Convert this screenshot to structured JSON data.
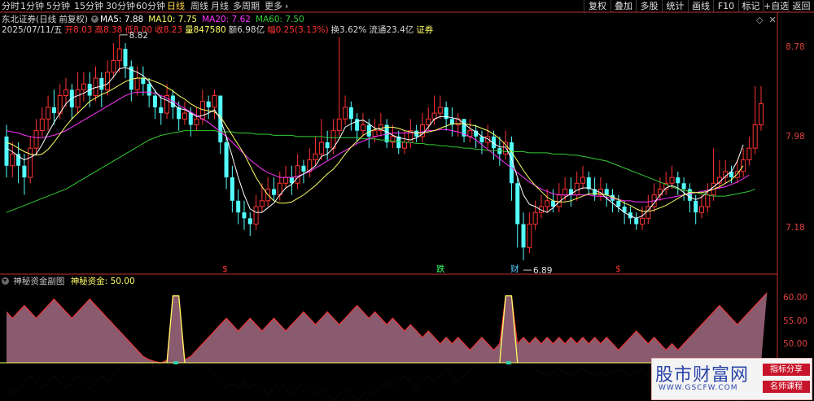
{
  "tabs": [
    "分时",
    "1分钟",
    "5分钟",
    "15分钟",
    "30分钟",
    "60分钟",
    "日线",
    "周线",
    "月线",
    "多周期",
    "更多"
  ],
  "active_tab": "日线",
  "more_icon": "chevron-right-icon",
  "toolbar": [
    "复权",
    "叠加",
    "多股",
    "统计",
    "画线",
    "F10",
    "标记",
    "+自选",
    "返回"
  ],
  "legend1": {
    "stock": "东北证券",
    "mode": "(日线 前复权)",
    "ma5": "MA5: 7.88",
    "ma10": "MA10: 7.75",
    "ma20": "MA20: 7.62",
    "ma60": "MA60: 7.50"
  },
  "legend2": {
    "date": "2025/07/11/五",
    "open": "开8.03",
    "high": "高8.38",
    "low": "低8.00",
    "close": "收8.23",
    "vol": "量847580",
    "amount": "额6.98亿",
    "change": "幅0.25(3.13%)",
    "turnover": "换3.62%",
    "float": "流通23.4亿",
    "tag": "证券"
  },
  "price_axis": [
    "8.78",
    "7.98",
    "7.18"
  ],
  "annotations": {
    "high": "8.82",
    "low": "6.89",
    "markers": [
      "$",
      "跌",
      "财",
      "$"
    ]
  },
  "sub_legend": {
    "title": "神秘资金副图",
    "series": "神秘资金: 50.00"
  },
  "sub_axis": [
    "60.00",
    "55.00",
    "50.00"
  ],
  "watermark": {
    "title": "股市财富网",
    "url": "WWW.GSCFW.COM",
    "tags": [
      "指标分享",
      "名师课程"
    ]
  },
  "colors": {
    "up": "#ff3333",
    "down": "#54ffff",
    "ma5": "#ffffff",
    "ma10": "#ffff66",
    "ma20": "#ff33ff",
    "ma60": "#33cc33",
    "sub_fill": "#8a5a6e",
    "sub_line": "#ff3333",
    "sub_yellow": "#ffff66"
  },
  "chart_data": {
    "type": "candlestick",
    "ylim": [
      6.8,
      9.0
    ],
    "candles": [
      [
        7.95,
        7.7,
        8.05,
        7.6
      ],
      [
        7.7,
        7.8,
        7.9,
        7.6
      ],
      [
        7.8,
        7.7,
        7.9,
        7.55
      ],
      [
        7.7,
        7.6,
        7.8,
        7.45
      ],
      [
        7.6,
        7.85,
        7.95,
        7.55
      ],
      [
        7.85,
        8.0,
        8.1,
        7.8
      ],
      [
        8.0,
        8.1,
        8.2,
        7.95
      ],
      [
        8.1,
        8.2,
        8.3,
        8.0
      ],
      [
        8.2,
        8.15,
        8.35,
        8.05
      ],
      [
        8.15,
        8.3,
        8.4,
        8.1
      ],
      [
        8.3,
        8.35,
        8.45,
        8.2
      ],
      [
        8.35,
        8.2,
        8.4,
        8.1
      ],
      [
        8.2,
        8.35,
        8.5,
        8.15
      ],
      [
        8.35,
        8.4,
        8.5,
        8.25
      ],
      [
        8.4,
        8.3,
        8.5,
        8.2
      ],
      [
        8.3,
        8.45,
        8.55,
        8.25
      ],
      [
        8.45,
        8.35,
        8.5,
        8.2
      ],
      [
        8.35,
        8.5,
        8.6,
        8.3
      ],
      [
        8.5,
        8.6,
        8.75,
        8.45
      ],
      [
        8.6,
        8.7,
        8.82,
        8.5
      ],
      [
        8.7,
        8.55,
        8.75,
        8.45
      ],
      [
        8.55,
        8.35,
        8.6,
        8.25
      ],
      [
        8.35,
        8.45,
        8.55,
        8.3
      ],
      [
        8.45,
        8.4,
        8.55,
        8.3
      ],
      [
        8.4,
        8.3,
        8.45,
        8.2
      ],
      [
        8.3,
        8.2,
        8.35,
        8.1
      ],
      [
        8.2,
        8.15,
        8.3,
        8.05
      ],
      [
        8.15,
        8.3,
        8.4,
        8.1
      ],
      [
        8.3,
        8.2,
        8.35,
        8.1
      ],
      [
        8.2,
        8.1,
        8.25,
        8.0
      ],
      [
        8.1,
        8.15,
        8.25,
        8.05
      ],
      [
        8.15,
        8.05,
        8.2,
        7.95
      ],
      [
        8.05,
        8.1,
        8.2,
        8.0
      ],
      [
        8.1,
        8.25,
        8.35,
        8.05
      ],
      [
        8.25,
        8.2,
        8.3,
        8.1
      ],
      [
        8.2,
        8.3,
        8.35,
        8.1
      ],
      [
        8.3,
        7.9,
        8.3,
        7.8
      ],
      [
        7.9,
        7.6,
        7.95,
        7.5
      ],
      [
        7.6,
        7.4,
        7.7,
        7.3
      ],
      [
        7.4,
        7.3,
        7.5,
        7.2
      ],
      [
        7.3,
        7.25,
        7.4,
        7.15
      ],
      [
        7.25,
        7.2,
        7.3,
        7.1
      ],
      [
        7.2,
        7.35,
        7.45,
        7.15
      ],
      [
        7.35,
        7.4,
        7.55,
        7.3
      ],
      [
        7.4,
        7.5,
        7.6,
        7.35
      ],
      [
        7.5,
        7.45,
        7.6,
        7.4
      ],
      [
        7.45,
        7.55,
        7.65,
        7.4
      ],
      [
        7.55,
        7.6,
        7.7,
        7.5
      ],
      [
        7.6,
        7.55,
        7.7,
        7.45
      ],
      [
        7.55,
        7.7,
        7.8,
        7.5
      ],
      [
        7.7,
        7.65,
        7.75,
        7.55
      ],
      [
        7.65,
        7.75,
        7.85,
        7.6
      ],
      [
        7.75,
        7.8,
        7.95,
        7.7
      ],
      [
        7.8,
        7.9,
        8.1,
        7.75
      ],
      [
        7.9,
        7.85,
        8.0,
        7.75
      ],
      [
        7.85,
        8.0,
        8.1,
        7.8
      ],
      [
        8.0,
        8.1,
        8.8,
        7.95
      ],
      [
        8.1,
        8.2,
        8.3,
        8.05
      ],
      [
        8.2,
        8.1,
        8.25,
        8.0
      ],
      [
        8.1,
        8.0,
        8.15,
        7.9
      ],
      [
        8.0,
        8.05,
        8.15,
        7.95
      ],
      [
        8.05,
        7.95,
        8.1,
        7.85
      ],
      [
        7.95,
        8.0,
        8.1,
        7.9
      ],
      [
        8.0,
        8.05,
        8.15,
        7.95
      ],
      [
        8.05,
        7.9,
        8.1,
        7.85
      ],
      [
        7.9,
        7.95,
        8.05,
        7.85
      ],
      [
        7.95,
        7.85,
        8.0,
        7.8
      ],
      [
        7.85,
        7.9,
        8.0,
        7.8
      ],
      [
        7.9,
        8.0,
        8.1,
        7.85
      ],
      [
        8.0,
        7.95,
        8.05,
        7.9
      ],
      [
        7.95,
        8.05,
        8.15,
        7.9
      ],
      [
        8.05,
        8.1,
        8.2,
        8.0
      ],
      [
        8.1,
        8.15,
        8.3,
        8.05
      ],
      [
        8.15,
        8.2,
        8.3,
        8.1
      ],
      [
        8.2,
        8.1,
        8.25,
        8.0
      ],
      [
        8.1,
        8.05,
        8.2,
        7.95
      ],
      [
        8.05,
        8.1,
        8.15,
        7.95
      ],
      [
        8.1,
        7.95,
        8.1,
        7.9
      ],
      [
        7.95,
        8.0,
        8.1,
        7.9
      ],
      [
        8.0,
        7.95,
        8.05,
        7.85
      ],
      [
        7.95,
        7.9,
        8.0,
        7.8
      ],
      [
        7.9,
        7.95,
        8.05,
        7.85
      ],
      [
        7.95,
        7.85,
        8.0,
        7.75
      ],
      [
        7.85,
        7.8,
        7.95,
        7.7
      ],
      [
        7.8,
        7.9,
        8.0,
        7.75
      ],
      [
        7.9,
        7.55,
        7.95,
        7.4
      ],
      [
        7.55,
        7.2,
        7.6,
        7.0
      ],
      [
        7.2,
        7.0,
        7.3,
        6.89
      ],
      [
        7.0,
        7.2,
        7.3,
        6.95
      ],
      [
        7.2,
        7.3,
        7.4,
        7.15
      ],
      [
        7.3,
        7.35,
        7.45,
        7.25
      ],
      [
        7.35,
        7.4,
        7.5,
        7.3
      ],
      [
        7.4,
        7.35,
        7.5,
        7.3
      ],
      [
        7.35,
        7.45,
        7.55,
        7.3
      ],
      [
        7.45,
        7.5,
        7.6,
        7.4
      ],
      [
        7.5,
        7.45,
        7.6,
        7.35
      ],
      [
        7.45,
        7.55,
        7.65,
        7.4
      ],
      [
        7.55,
        7.6,
        7.7,
        7.5
      ],
      [
        7.6,
        7.5,
        7.65,
        7.45
      ],
      [
        7.5,
        7.45,
        7.6,
        7.4
      ],
      [
        7.45,
        7.5,
        7.6,
        7.4
      ],
      [
        7.5,
        7.45,
        7.55,
        7.35
      ],
      [
        7.45,
        7.4,
        7.5,
        7.3
      ],
      [
        7.4,
        7.35,
        7.45,
        7.3
      ],
      [
        7.35,
        7.3,
        7.4,
        7.2
      ],
      [
        7.3,
        7.25,
        7.35,
        7.2
      ],
      [
        7.25,
        7.2,
        7.3,
        7.15
      ],
      [
        7.2,
        7.25,
        7.35,
        7.15
      ],
      [
        7.25,
        7.35,
        7.45,
        7.2
      ],
      [
        7.35,
        7.45,
        7.55,
        7.3
      ],
      [
        7.45,
        7.5,
        7.6,
        7.4
      ],
      [
        7.5,
        7.55,
        7.65,
        7.45
      ],
      [
        7.55,
        7.6,
        7.7,
        7.5
      ],
      [
        7.6,
        7.55,
        7.65,
        7.45
      ],
      [
        7.55,
        7.5,
        7.6,
        7.4
      ],
      [
        7.5,
        7.4,
        7.55,
        7.3
      ],
      [
        7.4,
        7.3,
        7.45,
        7.2
      ],
      [
        7.3,
        7.35,
        7.45,
        7.25
      ],
      [
        7.35,
        7.45,
        7.55,
        7.3
      ],
      [
        7.45,
        7.55,
        7.85,
        7.4
      ],
      [
        7.55,
        7.6,
        7.75,
        7.5
      ],
      [
        7.6,
        7.65,
        7.75,
        7.55
      ],
      [
        7.65,
        7.6,
        7.7,
        7.55
      ],
      [
        7.6,
        7.65,
        7.75,
        7.55
      ],
      [
        7.65,
        7.75,
        7.85,
        7.6
      ],
      [
        7.75,
        7.85,
        7.95,
        7.7
      ],
      [
        7.85,
        8.05,
        8.38,
        7.8
      ],
      [
        8.05,
        8.23,
        8.38,
        8.0
      ]
    ],
    "ma5": [
      7.85,
      7.82,
      7.78,
      7.75,
      7.77,
      7.8,
      7.88,
      7.98,
      8.07,
      8.15,
      8.23,
      8.28,
      8.3,
      8.32,
      8.35,
      8.37,
      8.38,
      8.4,
      8.46,
      8.53,
      8.54,
      8.52,
      8.5,
      8.47,
      8.42,
      8.34,
      8.28,
      8.26,
      8.23,
      8.19,
      8.18,
      8.15,
      8.12,
      8.13,
      8.15,
      8.18,
      8.1,
      7.95,
      7.78,
      7.6,
      7.45,
      7.33,
      7.3,
      7.3,
      7.34,
      7.38,
      7.45,
      7.51,
      7.54,
      7.6,
      7.63,
      7.66,
      7.7,
      7.78,
      7.8,
      7.85,
      7.93,
      8.03,
      8.06,
      8.08,
      8.09,
      8.06,
      8.02,
      8.01,
      7.99,
      7.96,
      7.94,
      7.93,
      7.92,
      7.94,
      7.97,
      8.03,
      8.1,
      8.12,
      8.12,
      8.11,
      8.1,
      8.06,
      8.02,
      7.99,
      7.95,
      7.93,
      7.89,
      7.86,
      7.86,
      7.76,
      7.6,
      7.45,
      7.37,
      7.35,
      7.32,
      7.3,
      7.34,
      7.39,
      7.43,
      7.46,
      7.49,
      7.51,
      7.51,
      7.49,
      7.47,
      7.42,
      7.38,
      7.34,
      7.3,
      7.27,
      7.25,
      7.27,
      7.32,
      7.38,
      7.45,
      7.51,
      7.53,
      7.51,
      7.47,
      7.43,
      7.41,
      7.43,
      7.48,
      7.52,
      7.56,
      7.61,
      7.65,
      7.74,
      7.88
    ],
    "ma10": [
      7.9,
      7.88,
      7.85,
      7.82,
      7.8,
      7.79,
      7.8,
      7.84,
      7.9,
      7.97,
      8.04,
      8.1,
      8.15,
      8.2,
      8.25,
      8.28,
      8.31,
      8.33,
      8.36,
      8.39,
      8.42,
      8.44,
      8.45,
      8.45,
      8.44,
      8.42,
      8.4,
      8.37,
      8.34,
      8.3,
      8.27,
      8.23,
      8.2,
      8.18,
      8.17,
      8.16,
      8.12,
      8.04,
      7.96,
      7.88,
      7.8,
      7.7,
      7.6,
      7.52,
      7.45,
      7.4,
      7.38,
      7.38,
      7.39,
      7.42,
      7.45,
      7.49,
      7.53,
      7.58,
      7.63,
      7.67,
      7.73,
      7.8,
      7.86,
      7.91,
      7.96,
      7.99,
      8.01,
      8.02,
      8.03,
      8.03,
      8.02,
      8.0,
      7.99,
      7.98,
      7.98,
      7.99,
      8.0,
      8.02,
      8.04,
      8.06,
      8.06,
      8.06,
      8.05,
      8.04,
      8.02,
      8.0,
      7.97,
      7.93,
      7.88,
      7.82,
      7.74,
      7.66,
      7.59,
      7.53,
      7.48,
      7.43,
      7.4,
      7.39,
      7.39,
      7.4,
      7.42,
      7.44,
      7.46,
      7.46,
      7.46,
      7.45,
      7.43,
      7.41,
      7.38,
      7.36,
      7.33,
      7.31,
      7.31,
      7.32,
      7.34,
      7.36,
      7.39,
      7.42,
      7.45,
      7.47,
      7.47,
      7.47,
      7.48,
      7.5,
      7.52,
      7.55,
      7.58,
      7.63,
      7.7
    ],
    "ma20": [
      8.0,
      7.99,
      7.98,
      7.96,
      7.95,
      7.94,
      7.94,
      7.95,
      7.96,
      7.98,
      8.0,
      8.03,
      8.06,
      8.09,
      8.12,
      8.15,
      8.18,
      8.21,
      8.24,
      8.27,
      8.3,
      8.32,
      8.33,
      8.33,
      8.33,
      8.32,
      8.3,
      8.28,
      8.25,
      8.22,
      8.19,
      8.16,
      8.13,
      8.1,
      8.07,
      8.03,
      7.99,
      7.95,
      7.9,
      7.85,
      7.8,
      7.75,
      7.71,
      7.67,
      7.64,
      7.62,
      7.6,
      7.6,
      7.6,
      7.61,
      7.63,
      7.65,
      7.68,
      7.71,
      7.74,
      7.77,
      7.8,
      7.83,
      7.86,
      7.89,
      7.91,
      7.93,
      7.95,
      7.96,
      7.97,
      7.98,
      7.98,
      7.98,
      7.98,
      7.98,
      7.99,
      8.0,
      8.0,
      8.01,
      8.01,
      8.0,
      7.99,
      7.97,
      7.95,
      7.92,
      7.88,
      7.84,
      7.8,
      7.76,
      7.72,
      7.68,
      7.64,
      7.6,
      7.56,
      7.53,
      7.5,
      7.48,
      7.46,
      7.45,
      7.45,
      7.45,
      7.45,
      7.45,
      7.45,
      7.44,
      7.44,
      7.43,
      7.42,
      7.41,
      7.4,
      7.4,
      7.39,
      7.39,
      7.39,
      7.4,
      7.41,
      7.42,
      7.43,
      7.44,
      7.45,
      7.46,
      7.47,
      7.48,
      7.49,
      7.5,
      7.51,
      7.52,
      7.54,
      7.56,
      7.59,
      7.62
    ],
    "ma60": [
      7.3,
      7.32,
      7.34,
      7.36,
      7.38,
      7.4,
      7.42,
      7.44,
      7.46,
      7.48,
      7.5,
      7.53,
      7.56,
      7.59,
      7.62,
      7.65,
      7.68,
      7.71,
      7.74,
      7.77,
      7.8,
      7.83,
      7.86,
      7.89,
      7.92,
      7.94,
      7.96,
      7.97,
      7.98,
      7.99,
      8.0,
      8.0,
      8.0,
      8.0,
      8.0,
      8.0,
      7.99,
      7.99,
      7.99,
      7.98,
      7.98,
      7.98,
      7.97,
      7.97,
      7.97,
      7.96,
      7.96,
      7.96,
      7.96,
      7.95,
      7.95,
      7.95,
      7.95,
      7.95,
      7.94,
      7.94,
      7.94,
      7.94,
      7.94,
      7.94,
      7.93,
      7.93,
      7.93,
      7.92,
      7.92,
      7.91,
      7.91,
      7.9,
      7.9,
      7.89,
      7.89,
      7.88,
      7.88,
      7.87,
      7.87,
      7.86,
      7.86,
      7.85,
      7.85,
      7.84,
      7.84,
      7.83,
      7.83,
      7.83,
      7.82,
      7.82,
      7.82,
      7.82,
      7.81,
      7.81,
      7.81,
      7.81,
      7.8,
      7.8,
      7.8,
      7.79,
      7.79,
      7.78,
      7.77,
      7.76,
      7.75,
      7.74,
      7.72,
      7.7,
      7.68,
      7.66,
      7.64,
      7.62,
      7.6,
      7.58,
      7.56,
      7.54,
      7.52,
      7.5,
      7.49,
      7.48,
      7.47,
      7.46,
      7.45,
      7.44,
      7.44,
      7.44,
      7.45,
      7.46,
      7.47,
      7.48,
      7.5
    ],
    "sub_series": [
      58,
      57,
      58,
      59,
      58,
      57,
      58,
      59,
      60,
      59,
      58,
      57,
      58,
      59,
      60,
      59,
      58,
      57,
      56,
      55,
      54,
      53,
      52,
      51,
      50.5,
      50.2,
      50,
      50.4,
      60.5,
      60.5,
      50.5,
      51,
      52,
      53,
      54,
      55,
      56,
      57,
      56,
      55,
      56,
      57,
      56,
      55,
      56,
      57,
      56,
      55,
      56,
      57,
      58,
      57,
      56,
      57,
      58,
      57,
      56,
      57,
      58,
      59,
      58,
      57,
      58,
      57,
      56,
      57,
      56,
      55,
      56,
      55,
      54,
      55,
      54,
      53,
      54,
      53,
      54,
      53,
      52,
      53,
      54,
      53,
      52,
      53,
      60.5,
      60.5,
      53,
      54,
      53,
      54,
      53,
      54,
      53,
      54,
      53,
      54,
      53,
      54,
      53,
      54,
      53,
      54,
      53,
      52,
      53,
      54,
      55,
      54,
      53,
      54,
      53,
      52,
      53,
      52,
      53,
      54,
      55,
      56,
      57,
      58,
      59,
      58,
      57,
      56,
      57,
      58,
      59,
      60,
      61
    ],
    "sub_lower": [
      46,
      45,
      46,
      47,
      48,
      47,
      46,
      47,
      48,
      47,
      46,
      47,
      48,
      47,
      46,
      47,
      48,
      47,
      48,
      49,
      49.4,
      49.6,
      49.8,
      49.9,
      50,
      50,
      50,
      50,
      50,
      50,
      50,
      49.9,
      49.6,
      49.4,
      49,
      48,
      47,
      46,
      47,
      46,
      47,
      46,
      47,
      46,
      45,
      46,
      47,
      46,
      45,
      46,
      47,
      46,
      45,
      46,
      45,
      44,
      45,
      46,
      45,
      44,
      45,
      46,
      45,
      46,
      47,
      46,
      47,
      48,
      47,
      46,
      47,
      48,
      47,
      48,
      49,
      48,
      47,
      48,
      49,
      49.5,
      49.8,
      49.9,
      50,
      50,
      50,
      50,
      50,
      49.8,
      49.5,
      49,
      48.5,
      48,
      48.5,
      49,
      48.5,
      48,
      48.5,
      49,
      48.5,
      48,
      48.5,
      48,
      48.5,
      49,
      48.5,
      48,
      48.5,
      49,
      48,
      47,
      48,
      47,
      46,
      47,
      46,
      47,
      46,
      47,
      48,
      47,
      46,
      47,
      46,
      45,
      44,
      45,
      46,
      45,
      46,
      45,
      44
    ],
    "sub_ylim": [
      44,
      62
    ]
  }
}
